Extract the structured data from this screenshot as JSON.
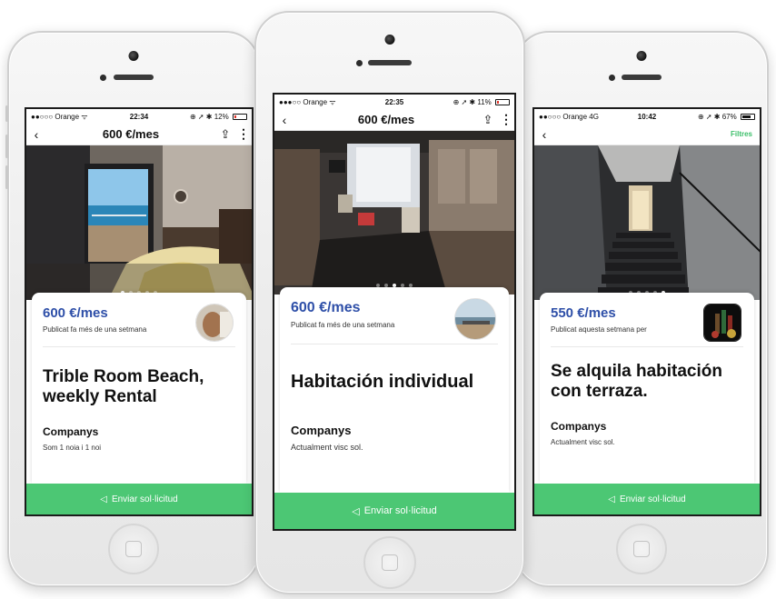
{
  "phones": [
    {
      "status": {
        "carrier": "●●○○○ Orange ᯤ",
        "time": "22:34",
        "right": "⊕ ➚ ✱ 12%",
        "battery_level": 0.12,
        "battery_color": "#e0352b"
      },
      "nav": {
        "back": "‹",
        "title": "600 €/mes",
        "share": "⇪",
        "more": "⋮"
      },
      "price": "600 €/mes",
      "published": "Publicat fa més de una setmana",
      "listing_title": "Trible Room Beach, weekly Rental",
      "section_title": "Companys",
      "section_text": "Som 1 noia i 1 noi",
      "cta": {
        "icon": "◁",
        "label": "Enviar sol·licitud"
      }
    },
    {
      "status": {
        "carrier": "●●●○○ Orange ᯤ",
        "time": "22:35",
        "right": "⊕ ➚ ✱ 11%",
        "battery_level": 0.11,
        "battery_color": "#e0352b"
      },
      "nav": {
        "back": "‹",
        "title": "600 €/mes",
        "share": "⇪",
        "more": "⋮"
      },
      "price": "600 €/mes",
      "published": "Publicat fa més de una setmana",
      "listing_title": "Habitación individual",
      "section_title": "Companys",
      "section_text": "Actualment visc sol.",
      "cta": {
        "icon": "◁",
        "label": "Enviar sol·licitud"
      }
    },
    {
      "status": {
        "carrier": "●●○○○ Orange 4G",
        "time": "10:42",
        "right": "⊕ ➚ ✱ 67%",
        "battery_level": 0.67,
        "battery_color": "#111111"
      },
      "nav": {
        "back": "‹",
        "filters": "Filtres"
      },
      "price": "550 €/mes",
      "published": "Publicat aquesta setmana per",
      "listing_title": "Se alquila habitación con terraza.",
      "section_title": "Companys",
      "section_text": "Actualment visc sol.",
      "cta": {
        "icon": "◁",
        "label": "Enviar sol·licitud"
      }
    }
  ],
  "colors": {
    "price": "#2e4fa8",
    "cta": "#4cc774",
    "filters": "#3cbf6a"
  }
}
